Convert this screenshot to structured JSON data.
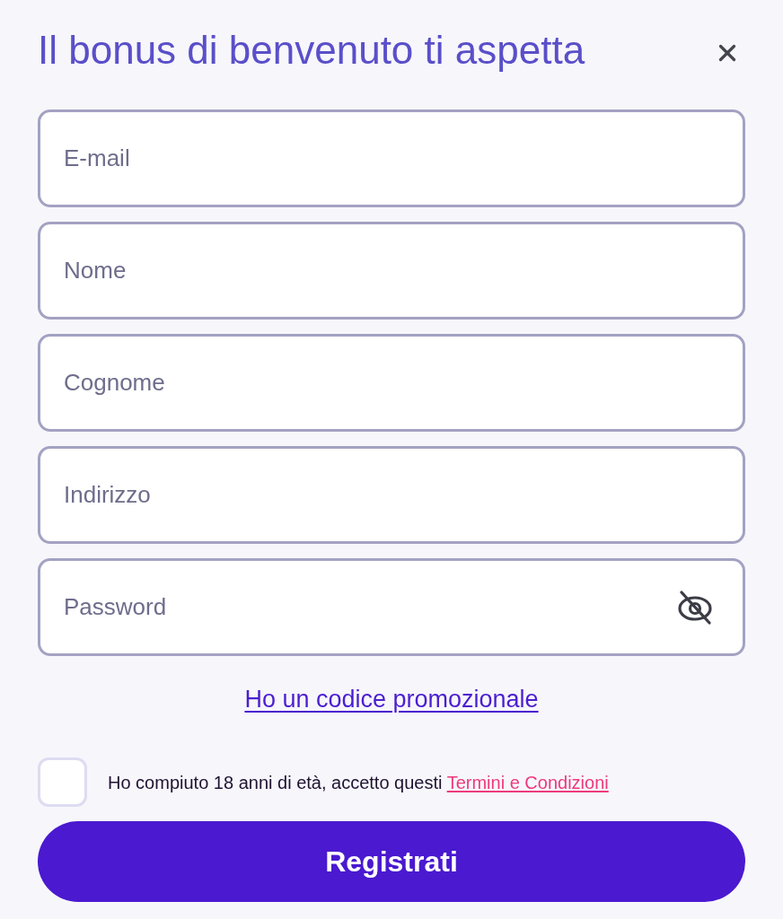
{
  "dialog": {
    "title": "Il bonus di benvenuto ti aspetta"
  },
  "fields": [
    {
      "kind": "text",
      "placeholder": "E-mail"
    },
    {
      "kind": "text",
      "placeholder": "Nome"
    },
    {
      "kind": "text",
      "placeholder": "Cognome"
    },
    {
      "kind": "text",
      "placeholder": "Indirizzo"
    },
    {
      "kind": "password",
      "placeholder": "Password"
    }
  ],
  "promo_link": "Ho un codice promozionale",
  "consent": {
    "checked": false,
    "text": "Ho compiuto 18 anni di età, accetto questi",
    "link": "Termini e Condizioni"
  },
  "submit_button": "Registrati"
}
